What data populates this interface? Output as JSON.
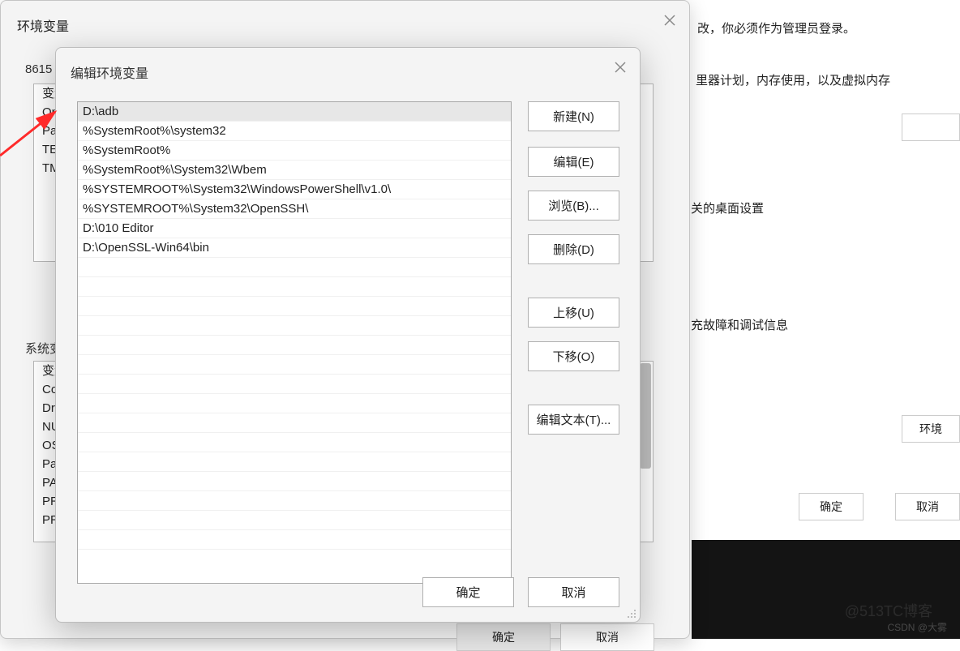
{
  "background": {
    "text1": "改，你必须作为管理员登录。",
    "text2": "里器计划，内存使用，以及虚拟内存",
    "text3": "关的桌面设置",
    "text4": "充故障和调试信息",
    "btn_env": "环境",
    "btn_ok": "确定",
    "btn_cancel": "取消"
  },
  "env_dialog": {
    "title": "环境变量",
    "label_user_prefix": "8615",
    "label_system": "系统变",
    "user_vars": [
      "变量",
      "On",
      "Pat",
      "TEI",
      "TM"
    ],
    "system_vars": [
      "变量",
      "Co",
      "Dri",
      "NU",
      "OS",
      "Pat",
      "PA",
      "PR",
      "PR"
    ],
    "btn_ok": "确定",
    "btn_cancel": "取消"
  },
  "edit_dialog": {
    "title": "编辑环境变量",
    "paths": [
      "D:\\adb",
      "%SystemRoot%\\system32",
      "%SystemRoot%",
      "%SystemRoot%\\System32\\Wbem",
      "%SYSTEMROOT%\\System32\\WindowsPowerShell\\v1.0\\",
      "%SYSTEMROOT%\\System32\\OpenSSH\\",
      "D:\\010 Editor",
      "D:\\OpenSSL-Win64\\bin"
    ],
    "selected_index": 0,
    "buttons": {
      "new": "新建(N)",
      "edit": "编辑(E)",
      "browse": "浏览(B)...",
      "delete": "删除(D)",
      "up": "上移(U)",
      "down": "下移(O)",
      "edit_text": "编辑文本(T)..."
    },
    "btn_ok": "确定",
    "btn_cancel": "取消"
  },
  "watermark": "CSDN @大雾",
  "watermark2": "@513TC博客"
}
